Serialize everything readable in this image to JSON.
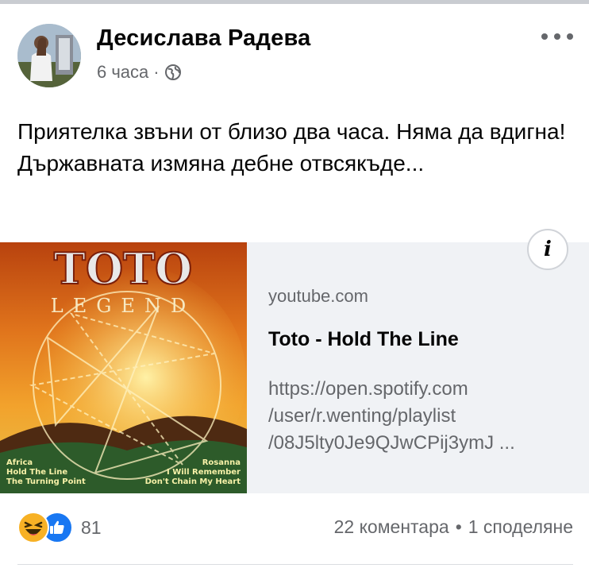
{
  "post": {
    "author": "Десислава Радева",
    "time": "6 часа",
    "separator": "·",
    "privacy_icon": "globe-icon",
    "more_icon": "more-options-icon",
    "text": "Приятелка звъни от близо два часа. Няма да вдигна! Държавната измяна дебне отвсякъде..."
  },
  "link_preview": {
    "thumbnail": {
      "band": "TOTO",
      "album": "LEGEND",
      "tracks_left": [
        "Africa",
        "Hold The Line",
        "The Turning Point"
      ],
      "tracks_right": [
        "Rosanna",
        "I Will Remember",
        "Don't Chain My Heart"
      ]
    },
    "domain": "youtube.com",
    "title": "Toto - Hold The Line",
    "description_lines": [
      "https://open.spotify.com",
      "/user/r.wenting/playlist",
      "/08J5lty0Je9QJwCPij3ymJ ..."
    ],
    "info_icon": "info-icon",
    "info_label": "i"
  },
  "engagement": {
    "reaction_icons": [
      "haha-reaction-icon",
      "like-reaction-icon"
    ],
    "reactions_count": "81",
    "comments": "22 коментара",
    "dot": "•",
    "shares": "1 споделяне"
  },
  "colors": {
    "secondary_text": "#65676b",
    "card_background": "#f0f2f5",
    "like_blue": "#1877f2",
    "haha_yellow": "#f7b125"
  }
}
